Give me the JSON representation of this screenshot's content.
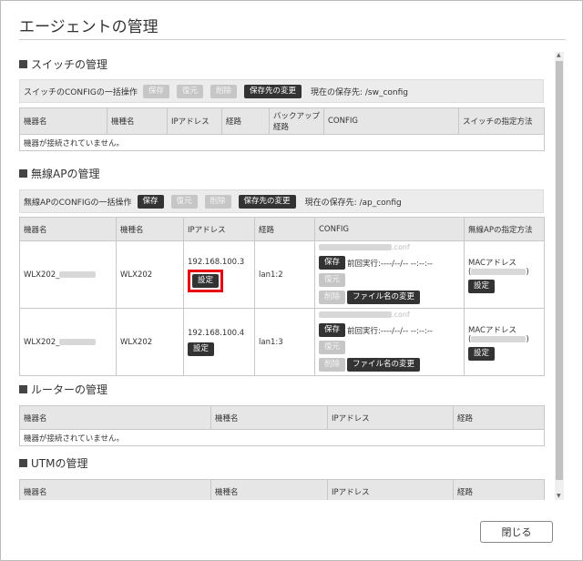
{
  "dialog": {
    "title": "エージェントの管理",
    "close_label": "閉じる"
  },
  "switch": {
    "title": "スイッチの管理",
    "bulk_label": "スイッチのCONFIGの一括操作",
    "save": "保存",
    "restore": "復元",
    "delete": "削除",
    "change_dest": "保存先の変更",
    "dest_text": "現在の保存先: /sw_config",
    "headers": [
      "機器名",
      "機種名",
      "IPアドレス",
      "経路",
      "バックアップ経路",
      "CONFIG",
      "スイッチの指定方法"
    ],
    "empty": "機器が接続されていません。"
  },
  "ap": {
    "title": "無線APの管理",
    "bulk_label": "無線APのCONFIGの一括操作",
    "save": "保存",
    "restore": "復元",
    "delete": "削除",
    "change_dest": "保存先の変更",
    "dest_text": "現在の保存先: /ap_config",
    "headers": [
      "機器名",
      "機種名",
      "IPアドレス",
      "経路",
      "CONFIG",
      "無線APの指定方法"
    ],
    "rows": [
      {
        "name": "WLX202_",
        "model": "WLX202",
        "ip": "192.168.100.3",
        "route": "lan1:2",
        "conf_ext": ".conf",
        "last_run": "前回実行:----/--/-- --:--:--",
        "method": "MACアドレス",
        "method_paren_open": "(",
        "method_paren_close": ")"
      },
      {
        "name": "WLX202_",
        "model": "WLX202",
        "ip": "192.168.100.4",
        "route": "lan1:3",
        "conf_ext": ".conf",
        "last_run": "前回実行:----/--/-- --:--:--",
        "method": "MACアドレス",
        "method_paren_open": "(",
        "method_paren_close": ")"
      }
    ],
    "set": "設定",
    "rename": "ファイル名の変更"
  },
  "router": {
    "title": "ルーターの管理",
    "headers": [
      "機器名",
      "機種名",
      "IPアドレス",
      "経路"
    ],
    "empty": "機器が接続されていません。"
  },
  "utm": {
    "title": "UTMの管理",
    "headers": [
      "機器名",
      "機種名",
      "IPアドレス",
      "経路"
    ]
  },
  "colors": {
    "highlight": "#e60012",
    "button": "#333333"
  }
}
